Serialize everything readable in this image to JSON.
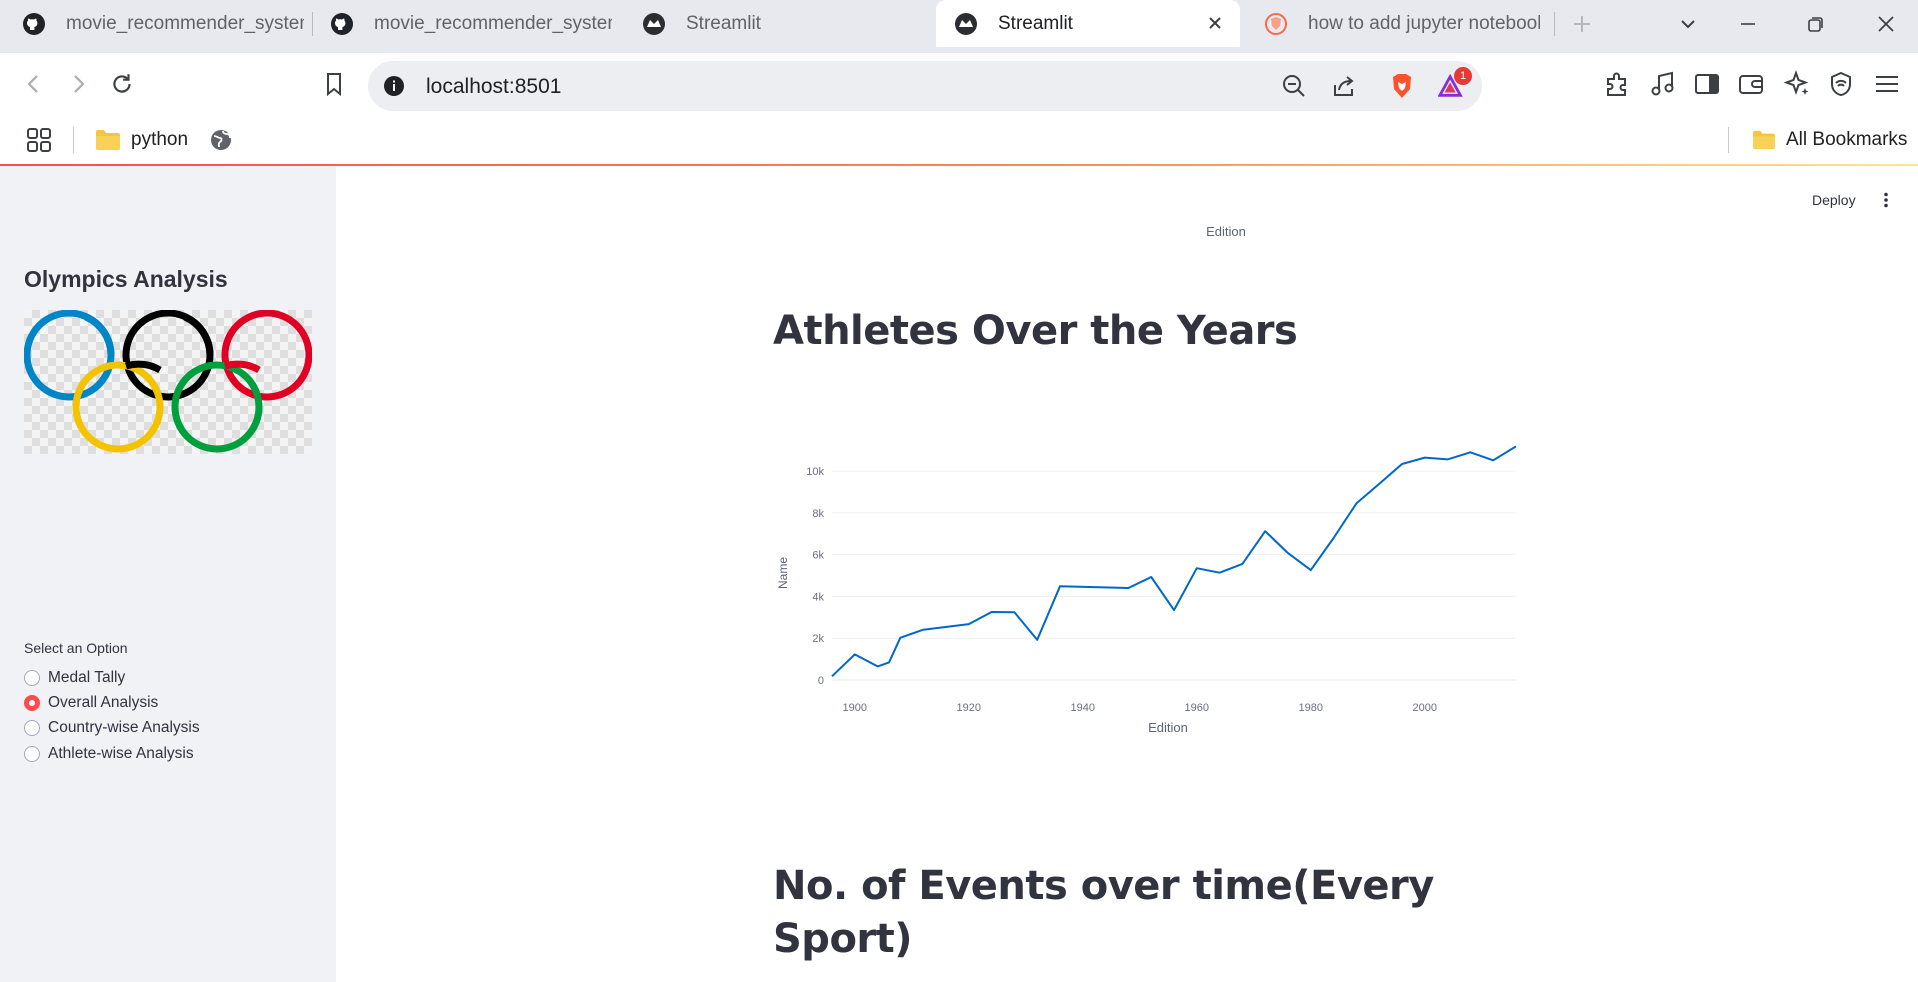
{
  "browser": {
    "tabs": [
      {
        "title": "movie_recommender_system/",
        "icon": "github-icon",
        "active": false
      },
      {
        "title": "movie_recommender_system/",
        "icon": "github-icon",
        "active": false
      },
      {
        "title": "Streamlit",
        "icon": "streamlit-icon",
        "active": false
      },
      {
        "title": "Streamlit",
        "icon": "streamlit-icon",
        "active": true
      },
      {
        "title": "how to add jupyter notebook",
        "icon": "brave-search-icon",
        "active": false
      }
    ],
    "url": "localhost:8501",
    "notification_badge": "1",
    "bookmarks": {
      "folder": "python",
      "all_bookmarks": "All Bookmarks"
    }
  },
  "app": {
    "sidebar": {
      "title": "Olympics Analysis",
      "image_alt": "olympic-rings",
      "radio": {
        "label": "Select an Option",
        "options": [
          "Medal Tally",
          "Overall Analysis",
          "Country-wise Analysis",
          "Athlete-wise Analysis"
        ],
        "selected": "Overall Analysis"
      }
    },
    "header": {
      "deploy_label": "Deploy"
    },
    "main": {
      "prev_chart_xlabel": "Edition",
      "section1_title": "Athletes Over the Years",
      "section2_title_line1": "No. of Events over time(Every",
      "section2_title_line2": "Sport)"
    }
  },
  "colors": {
    "accent": "#ff4b4b",
    "line": "#0068c9",
    "sidebar_bg": "#f0f2f6",
    "text": "#31333f"
  },
  "chart_data": {
    "type": "line",
    "xlabel": "Edition",
    "ylabel": "Name",
    "xlim": [
      1896,
      2016
    ],
    "ylim": [
      0,
      11200
    ],
    "x_ticks": [
      1900,
      1920,
      1940,
      1960,
      1980,
      2000
    ],
    "y_ticks": [
      0,
      2000,
      4000,
      6000,
      8000,
      10000
    ],
    "y_tick_labels": [
      "0",
      "2k",
      "4k",
      "6k",
      "8k",
      "10k"
    ],
    "grid": true,
    "series": [
      {
        "color": "#0068c9",
        "x": [
          1896,
          1900,
          1904,
          1906,
          1908,
          1912,
          1920,
          1924,
          1928,
          1932,
          1936,
          1948,
          1952,
          1956,
          1960,
          1964,
          1968,
          1972,
          1976,
          1980,
          1984,
          1988,
          1992,
          1996,
          2000,
          2004,
          2008,
          2012,
          2016
        ],
        "y": [
          176,
          1224,
          650,
          841,
          2024,
          2409,
          2676,
          3256,
          3246,
          1922,
          4484,
          4404,
          4932,
          3347,
          5352,
          5137,
          5558,
          7123,
          6075,
          5259,
          6797,
          8454,
          9385,
          10339,
          10647,
          10557,
          10899,
          10517,
          11179
        ]
      }
    ]
  }
}
